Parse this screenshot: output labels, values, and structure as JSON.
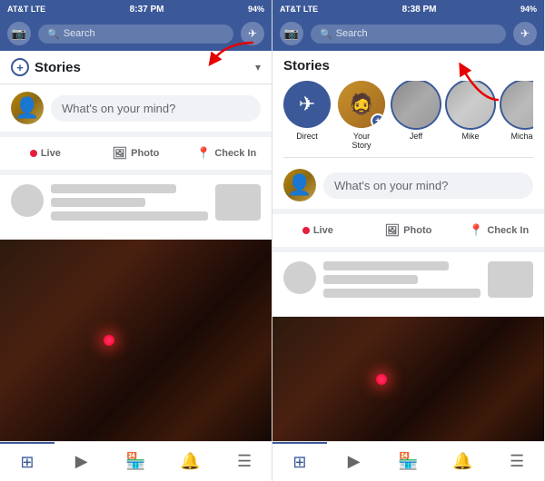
{
  "left_panel": {
    "status": {
      "carrier": "AT&T LTE",
      "time": "8:37 PM",
      "battery": "94%"
    },
    "search": {
      "placeholder": "Search"
    },
    "stories": {
      "title": "Stories",
      "chevron": "▾"
    },
    "post_box": {
      "placeholder": "What's on your mind?"
    },
    "actions": {
      "live": "Live",
      "photo": "Photo",
      "checkin": "Check In"
    },
    "nav_items": [
      "🏠",
      "▶",
      "🏪",
      "🔔",
      "☰"
    ]
  },
  "right_panel": {
    "status": {
      "carrier": "AT&T LTE",
      "time": "8:38 PM",
      "battery": "94%"
    },
    "search": {
      "placeholder": "Search"
    },
    "stories": {
      "title": "Stories",
      "items": [
        {
          "label": "Direct",
          "type": "direct"
        },
        {
          "label": "Your Story",
          "type": "own"
        },
        {
          "label": "Jeff",
          "type": "person"
        },
        {
          "label": "Mike",
          "type": "person"
        },
        {
          "label": "Michael",
          "type": "person"
        }
      ]
    },
    "post_box": {
      "placeholder": "What's on your mind?"
    },
    "actions": {
      "live": "Live",
      "photo": "Photo",
      "checkin": "Check In"
    },
    "nav_items": [
      "🏠",
      "▶",
      "🏪",
      "🔔",
      "☰"
    ]
  }
}
